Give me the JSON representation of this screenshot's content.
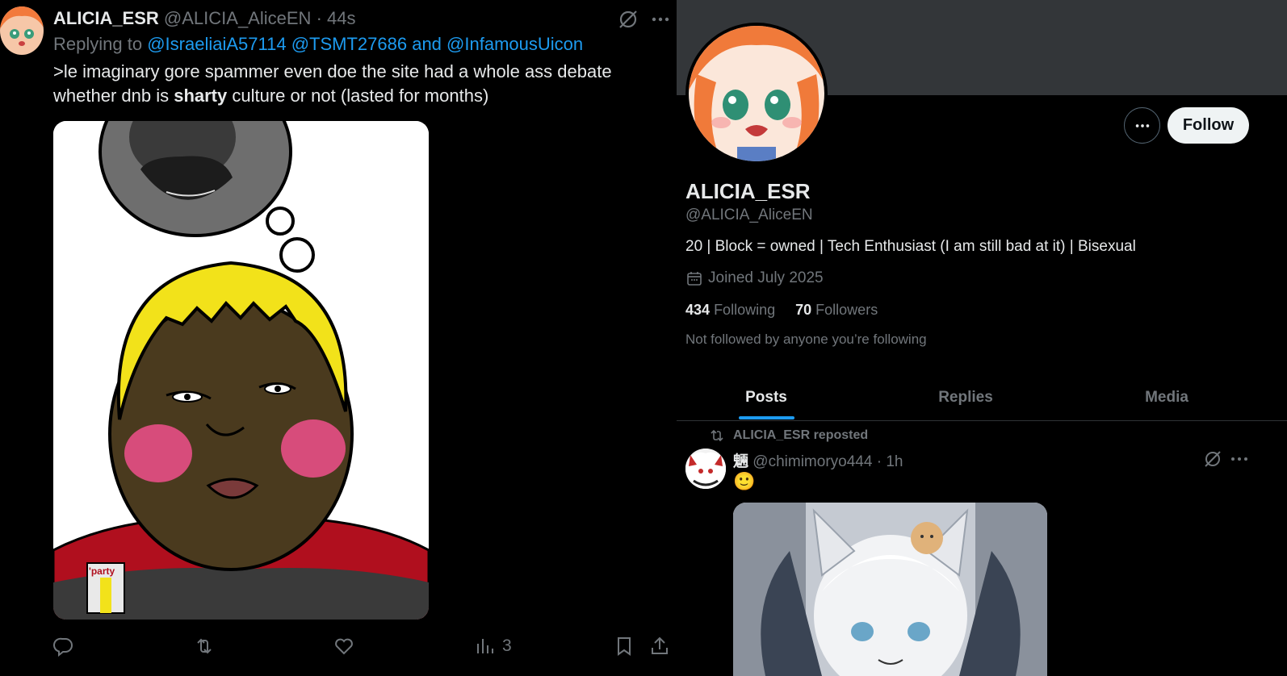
{
  "tweet": {
    "author_name": "ALICIA_ESR",
    "author_handle": "@ALICIA_AliceEN",
    "dot": "·",
    "time": "44s",
    "replying_prefix": "Replying to",
    "mention_1": "@IsraeliaiA57114",
    "mention_2": "@TSMT27686",
    "and": "and",
    "mention_3": "@InfamousUicon",
    "text_part1": ">le imaginary gore spammer even doe the site had a whole ass debate whether dnb is ",
    "text_bold": "sharty",
    "text_part2": " culture or not (lasted for months)",
    "shirt_label": "'party",
    "views_count": "3"
  },
  "profile": {
    "name": "ALICIA_ESR",
    "handle": "@ALICIA_AliceEN",
    "bio": "20 | Block = owned | Tech Enthusiast (I am still bad at it) | Bisexual",
    "joined": "Joined July 2025",
    "following_count": "434",
    "following_label": "Following",
    "followers_count": "70",
    "followers_label": "Followers",
    "not_followed": "Not followed by anyone you’re following",
    "follow_button": "Follow",
    "tabs": [
      {
        "label": "Posts",
        "active": true
      },
      {
        "label": "Replies",
        "active": false
      },
      {
        "label": "Media",
        "active": false
      }
    ]
  },
  "repost": {
    "reposted_by": "ALICIA_ESR reposted",
    "author_name": "魎",
    "author_handle": "@chimimoryo444",
    "dot": "·",
    "time": "1h",
    "emoji": "🙂"
  },
  "colors": {
    "accent": "#1d9bf0",
    "text_primary": "#e7e9ea",
    "text_secondary": "#71767b",
    "banner": "#333639",
    "follow_bg": "#eff3f4"
  },
  "icons": [
    "grok-icon",
    "more-icon",
    "reply-icon",
    "retweet-icon",
    "like-icon",
    "views-icon",
    "bookmark-icon",
    "share-icon",
    "calendar-icon",
    "repost-icon"
  ]
}
